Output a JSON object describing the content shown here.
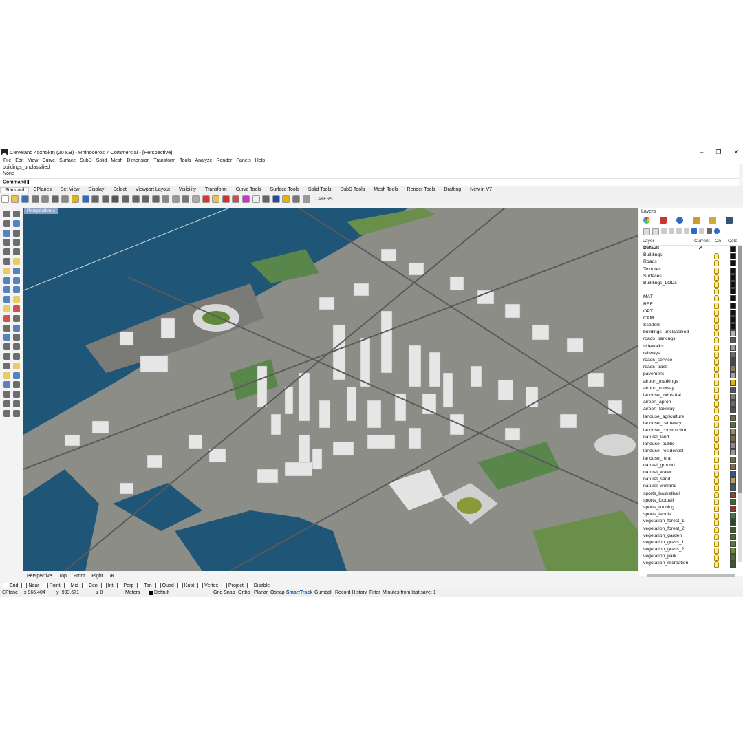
{
  "window": {
    "title": "Cleveland 45x45km (20 KB) - Rhinoceros 7 Commercial - [Perspective]",
    "min": "–",
    "max": "❐",
    "close": "✕"
  },
  "menu": [
    "File",
    "Edit",
    "View",
    "Curve",
    "Surface",
    "SubD",
    "Solid",
    "Mesh",
    "Dimension",
    "Transform",
    "Tools",
    "Analyze",
    "Render",
    "Panels",
    "Help"
  ],
  "history": {
    "line1": "buildings_unclassified",
    "line2": "None",
    "command_label": "Command:"
  },
  "toolbar_tabs": [
    "Standard",
    "CPlanes",
    "Set View",
    "Display",
    "Select",
    "Viewport Layout",
    "Visibility",
    "Transform",
    "Curve Tools",
    "Surface Tools",
    "Solid Tools",
    "SubD Tools",
    "Mesh Tools",
    "Render Tools",
    "Drafting",
    "New in V7"
  ],
  "toolbar_layers_label": "LAYERS",
  "viewport": {
    "label": "Perspective"
  },
  "viewport_tabs": [
    "Perspective",
    "Top",
    "Front",
    "Right"
  ],
  "osnaps": [
    "End",
    "Near",
    "Point",
    "Mid",
    "Cen",
    "Int",
    "Perp",
    "Tan",
    "Quad",
    "Knot",
    "Vertex",
    "Project",
    "Disable"
  ],
  "status": {
    "cplane": "CPlane",
    "x": "x 966.404",
    "y": "y -993.671",
    "z": "z 0",
    "units": "Meters",
    "layer": "Default",
    "grid_snap": "Grid Snap",
    "ortho": "Ortho",
    "planar": "Planar",
    "osnap": "Osnap",
    "smarttrack": "SmartTrack",
    "gumball": "Gumball",
    "record_history": "Record History",
    "filter": "Filter",
    "last_save": "Minutes from last save: 1"
  },
  "layers_panel": {
    "title": "Layers",
    "header": {
      "layer": "Layer",
      "current": "Current",
      "on": "On",
      "color": "Colo"
    },
    "rows": [
      {
        "name": "Default",
        "color": "#111111",
        "current": true
      },
      {
        "name": "Buildings",
        "color": "#111111"
      },
      {
        "name": "Roads",
        "color": "#111111"
      },
      {
        "name": "Textures",
        "color": "#111111"
      },
      {
        "name": "Surfaces",
        "color": "#111111"
      },
      {
        "name": "Buildings_LODs",
        "color": "#111111"
      },
      {
        "name": "--------",
        "color": "#111111"
      },
      {
        "name": "MAT",
        "color": "#111111"
      },
      {
        "name": "REF",
        "color": "#111111"
      },
      {
        "name": "OPT",
        "color": "#111111"
      },
      {
        "name": "CAM",
        "color": "#111111"
      },
      {
        "name": "Scatters",
        "color": "#111111"
      },
      {
        "name": "buildings_unclassified",
        "color": "#b0b0b0"
      },
      {
        "name": "roads_parkings",
        "color": "#5a5a5a"
      },
      {
        "name": "sidewalks",
        "color": "#9a9a9a"
      },
      {
        "name": "railways",
        "color": "#6a6a6a"
      },
      {
        "name": "roads_service",
        "color": "#4a4a4a"
      },
      {
        "name": "roads_track",
        "color": "#8a7a5a"
      },
      {
        "name": "pavement",
        "color": "#a0a0a0"
      },
      {
        "name": "airport_markings",
        "color": "#e3b400"
      },
      {
        "name": "airport_runway",
        "color": "#555555"
      },
      {
        "name": "landuse_industrial",
        "color": "#7a7a7a"
      },
      {
        "name": "airport_apron",
        "color": "#6a6a6a"
      },
      {
        "name": "airport_taxiway",
        "color": "#505050"
      },
      {
        "name": "landuse_agriculture",
        "color": "#6a6a3a"
      },
      {
        "name": "landuse_cemetery",
        "color": "#5a6a4a"
      },
      {
        "name": "landuse_construction",
        "color": "#9a8a6a"
      },
      {
        "name": "natural_land",
        "color": "#7a6a4a"
      },
      {
        "name": "landuse_public",
        "color": "#8a8a8a"
      },
      {
        "name": "landuse_residential",
        "color": "#9a9a9a"
      },
      {
        "name": "landuse_rural",
        "color": "#6a6a4a"
      },
      {
        "name": "natural_ground",
        "color": "#7a6a5a"
      },
      {
        "name": "natural_water",
        "color": "#2a5a8a"
      },
      {
        "name": "natural_sand",
        "color": "#b0a070"
      },
      {
        "name": "natural_wetland",
        "color": "#3a5a6a"
      },
      {
        "name": "sports_basketball",
        "color": "#8a4a2a"
      },
      {
        "name": "sports_football",
        "color": "#3a6a2a"
      },
      {
        "name": "sports_running",
        "color": "#8a3a2a"
      },
      {
        "name": "sports_tennis",
        "color": "#3a7a4a"
      },
      {
        "name": "vegetation_forest_1",
        "color": "#2a4a1a"
      },
      {
        "name": "vegetation_forest_2",
        "color": "#3a5a2a"
      },
      {
        "name": "vegetation_garden",
        "color": "#4a6a2a"
      },
      {
        "name": "vegetation_grass_1",
        "color": "#5a7a3a"
      },
      {
        "name": "vegetation_grass_2",
        "color": "#6a8a3a"
      },
      {
        "name": "vegetation_park",
        "color": "#4a6a3a"
      },
      {
        "name": "vegetation_recreation",
        "color": "#3a5a2a"
      }
    ]
  }
}
